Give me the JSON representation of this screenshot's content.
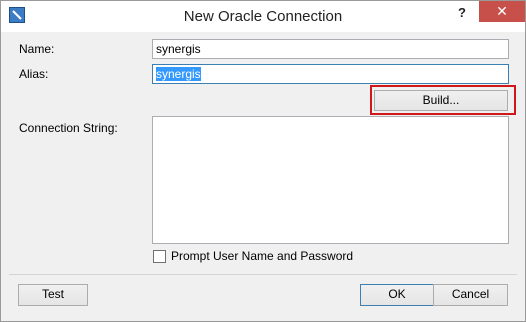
{
  "window": {
    "title": "New Oracle Connection",
    "help_label": "?",
    "close_label": "✕",
    "icon": "oracle-connection-icon"
  },
  "form": {
    "name_label": "Name:",
    "name_value": "synergis",
    "alias_label": "Alias:",
    "alias_value": "synergis",
    "build_label": "Build...",
    "connection_string_label": "Connection String:",
    "connection_string_value": "",
    "prompt_label": "Prompt User Name and Password",
    "prompt_checked": false
  },
  "footer": {
    "test_label": "Test",
    "ok_label": "OK",
    "cancel_label": "Cancel"
  },
  "colors": {
    "close_button": "#c7504a",
    "selection": "#3399ff",
    "highlight_box": "#d01818"
  }
}
